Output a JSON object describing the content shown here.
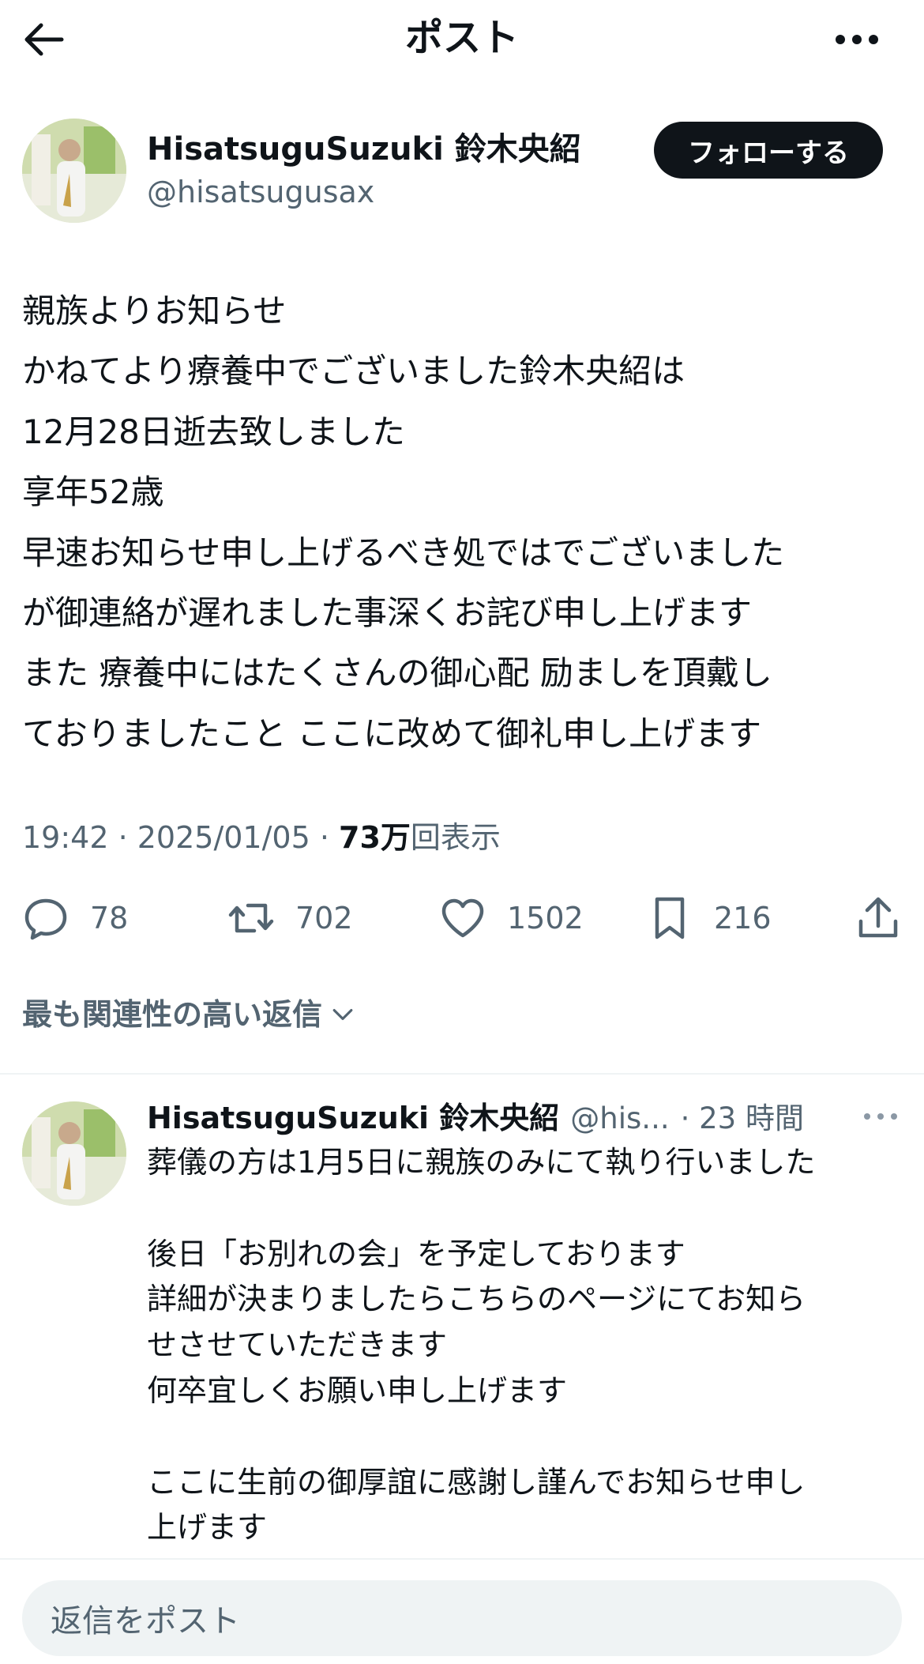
{
  "header": {
    "title": "ポスト",
    "back_icon": "arrow-left-icon",
    "more_icon": "more-horizontal-icon"
  },
  "post": {
    "author_name": "HisatsuguSuzuki 鈴木央紹",
    "author_handle": "@hisatsugusax",
    "follow_label": "フォローする",
    "body_lines": [
      "親族よりお知らせ",
      "かねてより療養中でございました鈴木央紹は",
      "12月28日逝去致しました",
      "享年52歳",
      "早速お知らせ申し上げるべき処ではでございました",
      "が御連絡が遅れました事深くお詫び申し上げます",
      "また 療養中にはたくさんの御心配 励ましを頂戴し",
      "ておりましたこと ここに改めて御礼申し上げます"
    ],
    "meta_time": "19:42 · 2025/01/05 · ",
    "views_count": "73万",
    "views_label": "回表示",
    "actions": {
      "replies": "78",
      "reposts": "702",
      "likes": "1502",
      "bookmarks": "216"
    }
  },
  "replies_sort": {
    "label": "最も関連性の高い返信"
  },
  "reply": {
    "author_name": "HisatsuguSuzuki 鈴木央紹",
    "author_handle": "@his...",
    "time": "· 23 時間",
    "body_lines": [
      "葬儀の方は1月5日に親族のみにて執り行いました",
      "",
      "後日「お別れの会」を予定しております",
      "詳細が決まりましたらこちらのページにてお知ら",
      "せさせていただきます",
      "何卒宜しくお願い申し上げます",
      "",
      "ここに生前の御厚誼に感謝し謹んでお知らせ申し",
      "上げます"
    ]
  },
  "compose": {
    "placeholder": "返信をポスト"
  },
  "colors": {
    "text": "#0f1419",
    "secondary": "#536471",
    "divider": "#eff3f4",
    "button_bg": "#0f1419"
  }
}
